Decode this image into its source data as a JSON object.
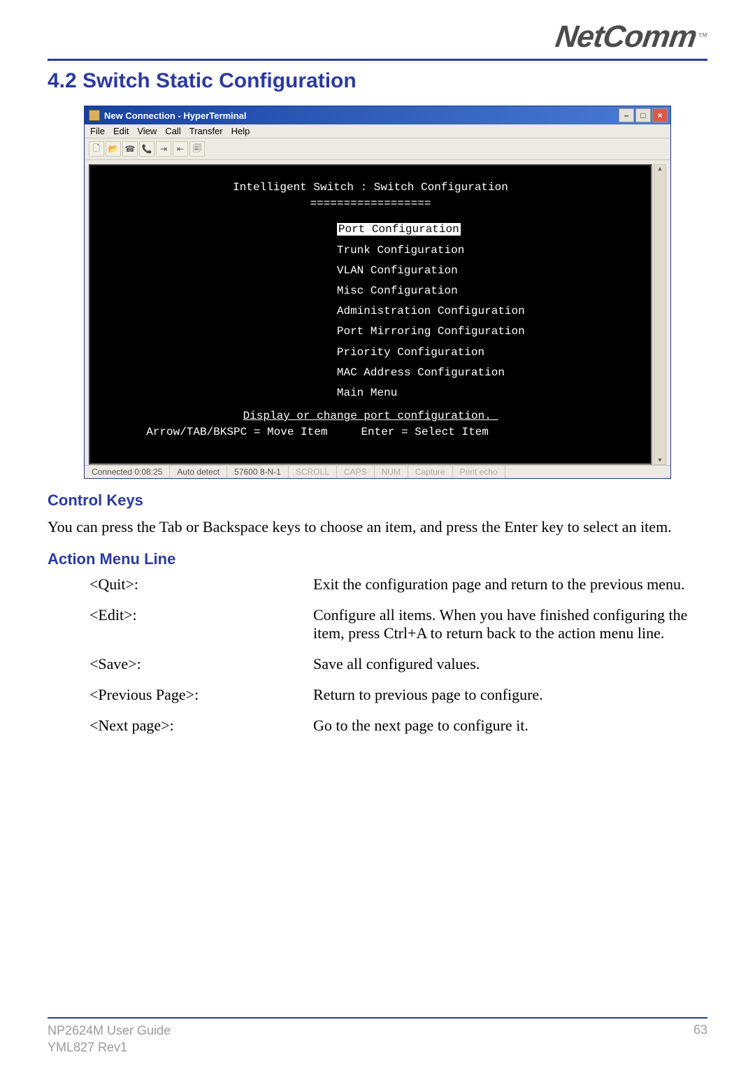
{
  "logo": {
    "brand": "NetComm",
    "tm": "™"
  },
  "section_title": "4.2 Switch Static Configuration",
  "hyperterminal": {
    "title": "New Connection - HyperTerminal",
    "win_buttons": {
      "min": "–",
      "max": "□",
      "close": "×"
    },
    "menu": [
      "File",
      "Edit",
      "View",
      "Call",
      "Transfer",
      "Help"
    ],
    "toolbar_glyphs": [
      "🗋",
      "📂",
      "☎",
      "📞",
      "⇥",
      "⇤",
      "🗐"
    ],
    "terminal": {
      "header": "Intelligent Switch : Switch Configuration",
      "divider": "==================",
      "items": [
        {
          "label": "Port Configuration",
          "selected": true
        },
        {
          "label": "Trunk Configuration",
          "selected": false
        },
        {
          "label": "VLAN Configuration",
          "selected": false
        },
        {
          "label": "Misc Configuration",
          "selected": false
        },
        {
          "label": "Administration Configuration",
          "selected": false
        },
        {
          "label": "Port Mirroring Configuration",
          "selected": false
        },
        {
          "label": "Priority Configuration",
          "selected": false
        },
        {
          "label": "MAC Address Configuration",
          "selected": false
        },
        {
          "label": "Main Menu",
          "selected": false
        }
      ],
      "help_line": "Display or change port configuration._",
      "help_line2": "Arrow/TAB/BKSPC = Move Item     Enter = Select Item"
    },
    "status": {
      "connected": "Connected 0:08:25",
      "detect": "Auto detect",
      "baud": "57600 8-N-1",
      "flags": [
        "SCROLL",
        "CAPS",
        "NUM",
        "Capture",
        "Print echo"
      ]
    }
  },
  "control_keys": {
    "heading": "Control Keys",
    "para": "You can press the Tab or Backspace keys to choose an item, and press the Enter key to select an item."
  },
  "action_menu": {
    "heading": "Action Menu Line",
    "rows": [
      {
        "key": "<Quit>:",
        "desc": "Exit the configuration page and return to the previous menu."
      },
      {
        "key": "<Edit>:",
        "desc": "Configure all items. When you have finished configuring the item, press Ctrl+A to return back to the action menu line."
      },
      {
        "key": "<Save>:",
        "desc": "Save all configured values."
      },
      {
        "key": "<Previous Page>:",
        "desc": "Return to previous page to configure."
      },
      {
        "key": "<Next page>:",
        "desc": "Go to the next page to configure it."
      }
    ]
  },
  "footer": {
    "line1": "NP2624M User Guide",
    "line2": "YML827 Rev1",
    "page": "63"
  }
}
